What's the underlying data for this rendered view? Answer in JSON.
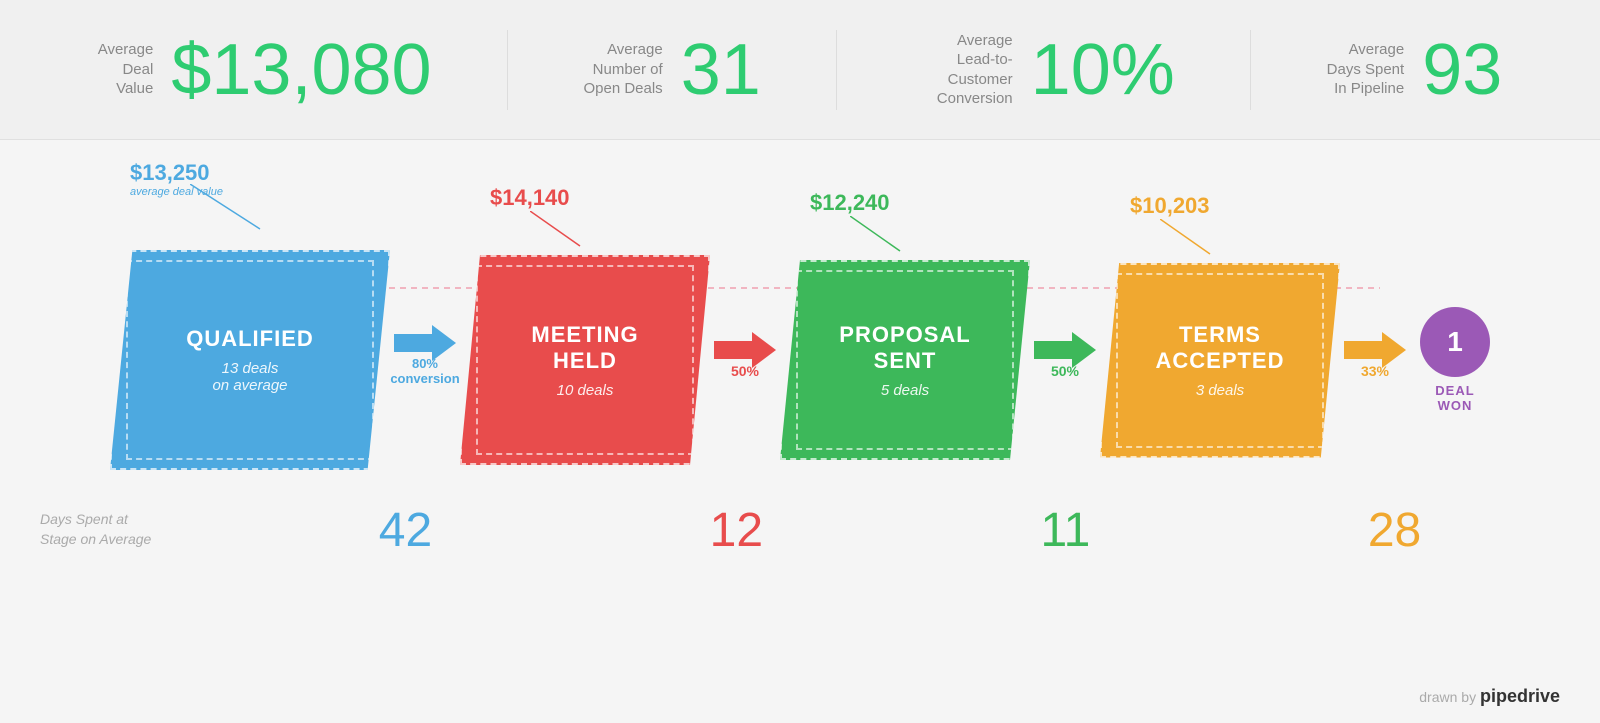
{
  "stats": [
    {
      "id": "avg-deal-value",
      "label": "Average\nDeal\nValue",
      "value": "$13,080"
    },
    {
      "id": "avg-open-deals",
      "label": "Average\nNumber of\nOpen Deals",
      "value": "31"
    },
    {
      "id": "avg-conversion",
      "label": "Average\nLead-to-Customer\nConversion",
      "value": "10%"
    },
    {
      "id": "avg-days",
      "label": "Average\nDays Spent\nIn Pipeline",
      "value": "93"
    }
  ],
  "stages": [
    {
      "id": "qualified",
      "name": "QUALIFIED",
      "deals": "13 deals\non average",
      "deal_value": "$13,250",
      "color": "#4da9e0",
      "days": "42"
    },
    {
      "id": "meeting-held",
      "name": "MEETING\nHELD",
      "deals": "10 deals",
      "deal_value": "$14,140",
      "color": "#e84c4c",
      "days": "12"
    },
    {
      "id": "proposal-sent",
      "name": "PROPOSAL\nSENT",
      "deals": "5 deals",
      "deal_value": "$12,240",
      "color": "#3db85a",
      "days": "11"
    },
    {
      "id": "terms-accepted",
      "name": "TERMS\nACCEPTED",
      "deals": "3 deals",
      "deal_value": "$10,203",
      "color": "#f0a830",
      "days": "28"
    }
  ],
  "connectors": [
    {
      "label": "80%\nconversion",
      "color_class": "conv-blue",
      "arrow_class": "arrow-blue"
    },
    {
      "label": "50%",
      "color_class": "conv-red",
      "arrow_class": "arrow-red"
    },
    {
      "label": "50%",
      "color_class": "conv-green",
      "arrow_class": "arrow-green"
    },
    {
      "label": "33%",
      "color_class": "conv-orange",
      "arrow_class": "arrow-orange"
    }
  ],
  "deal_won": {
    "count": "1",
    "label": "DEAL\nWON"
  },
  "days_label": "Days Spent at\nStage on Average",
  "attribution": {
    "prefix": "drawn by",
    "brand": "pipedrive"
  },
  "avg_deal_value_sublabel": "average deal value"
}
